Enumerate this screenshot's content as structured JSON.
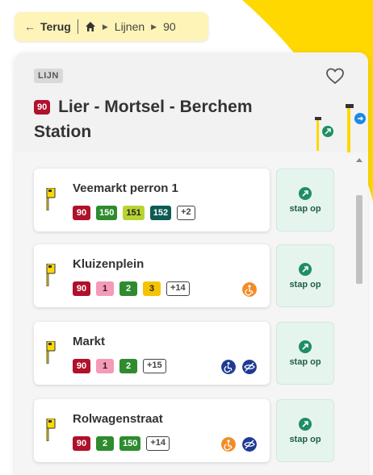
{
  "breadcrumb": {
    "back_label": "Terug",
    "items": [
      "Lijnen",
      "90"
    ]
  },
  "header": {
    "tag": "LIJN",
    "line_number": "90",
    "title": "Lier - Mortsel - Berchem Station",
    "line_color": "#b0112b"
  },
  "stops": [
    {
      "name": "Veemarkt perron 1",
      "lines": [
        {
          "label": "90",
          "bg": "#b0112b",
          "fg": "#ffffff"
        },
        {
          "label": "150",
          "bg": "#2e8b2e",
          "fg": "#ffffff"
        },
        {
          "label": "151",
          "bg": "#b7d433",
          "fg": "#222222"
        },
        {
          "label": "152",
          "bg": "#0e5a55",
          "fg": "#ffffff"
        }
      ],
      "more": "+2",
      "features": [],
      "action": "stap op"
    },
    {
      "name": "Kluizenplein",
      "lines": [
        {
          "label": "90",
          "bg": "#b0112b",
          "fg": "#ffffff"
        },
        {
          "label": "1",
          "bg": "#f59ab7",
          "fg": "#222222"
        },
        {
          "label": "2",
          "bg": "#2e8b2e",
          "fg": "#ffffff"
        },
        {
          "label": "3",
          "bg": "#f5c400",
          "fg": "#222222"
        }
      ],
      "more": "+14",
      "features": [
        "partial-accessible-icon"
      ],
      "action": "stap op"
    },
    {
      "name": "Markt",
      "lines": [
        {
          "label": "90",
          "bg": "#b0112b",
          "fg": "#ffffff"
        },
        {
          "label": "1",
          "bg": "#f59ab7",
          "fg": "#222222"
        },
        {
          "label": "2",
          "bg": "#2e8b2e",
          "fg": "#ffffff"
        }
      ],
      "more": "+15",
      "features": [
        "wheelchair-icon",
        "visually-impaired-icon"
      ],
      "action": "stap op"
    },
    {
      "name": "Rolwagenstraat",
      "lines": [
        {
          "label": "90",
          "bg": "#b0112b",
          "fg": "#ffffff"
        },
        {
          "label": "2",
          "bg": "#2e8b2e",
          "fg": "#ffffff"
        },
        {
          "label": "150",
          "bg": "#2e8b2e",
          "fg": "#ffffff"
        }
      ],
      "more": "+14",
      "features": [
        "partial-accessible-icon",
        "visually-impaired-icon"
      ],
      "action": "stap op"
    }
  ],
  "colors": {
    "brand_yellow": "#ffd800",
    "action_green": "#1f8f63"
  }
}
